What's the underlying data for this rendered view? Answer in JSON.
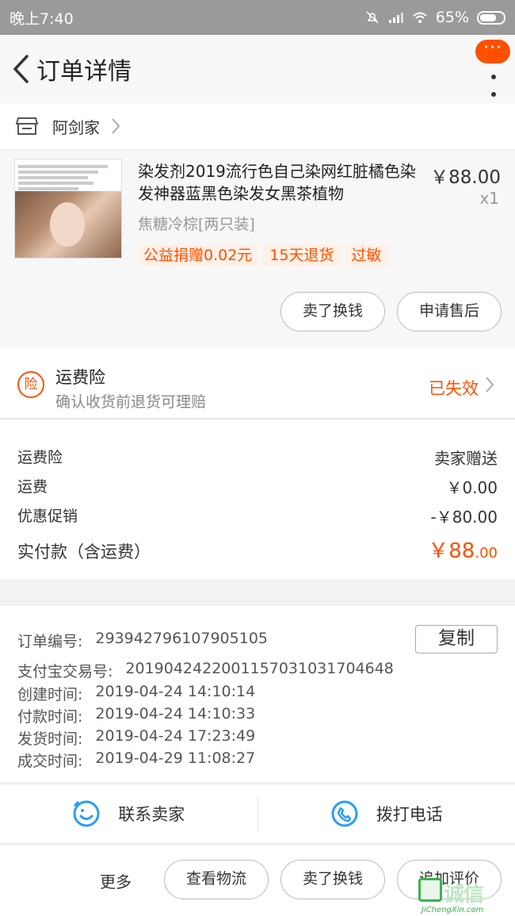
{
  "status_bar": {
    "time": "晚上7:40",
    "battery": "65%"
  },
  "nav": {
    "title": "订单详情",
    "badge": "···"
  },
  "shop": {
    "name": "阿剑家"
  },
  "product": {
    "title": "染发剂2019流行色自己染网红脏橘色染发神器蓝黑色染发女黑茶植物",
    "price": "￥88.00",
    "qty": "x1",
    "sku": "焦糖冷棕[两只装]",
    "tags": [
      "公益捐赠0.02元",
      "15天退货",
      "过敏"
    ],
    "buttons": {
      "sell": "卖了换钱",
      "aftersale": "申请售后"
    }
  },
  "insurance": {
    "icon": "险",
    "title": "运费险",
    "subtitle": "确认收货前退货可理赔",
    "status": "已失效"
  },
  "fees": {
    "rows": [
      {
        "label": "运费险",
        "value": "卖家赠送"
      },
      {
        "label": "运费",
        "value": "￥0.00"
      },
      {
        "label": "优惠促销",
        "value": "-￥80.00"
      }
    ],
    "paid_label": "实付款（含运费）",
    "paid_main": "￥88",
    "paid_dec": ".00"
  },
  "order_info": {
    "copy_label": "复制",
    "rows": [
      {
        "label": "订单编号:",
        "value": "293942796107905105"
      },
      {
        "label": "支付宝交易号:",
        "value": "2019042422001157031031704648"
      },
      {
        "label": "创建时间:",
        "value": "2019-04-24 14:10:14"
      },
      {
        "label": "付款时间:",
        "value": "2019-04-24 14:10:33"
      },
      {
        "label": "发货时间:",
        "value": "2019-04-24 17:23:49"
      },
      {
        "label": "成交时间:",
        "value": "2019-04-29 11:08:27"
      }
    ]
  },
  "contact": {
    "seller": "联系卖家",
    "phone": "拨打电话"
  },
  "bottom_bar": {
    "more": "更多",
    "buttons": [
      "查看物流",
      "卖了换钱",
      "追加评价"
    ]
  },
  "watermark": {
    "chars": "诚信",
    "url": "JiChengXin.com"
  },
  "colors": {
    "accent": "#ff5000",
    "text": "#333333",
    "muted": "#999999"
  }
}
